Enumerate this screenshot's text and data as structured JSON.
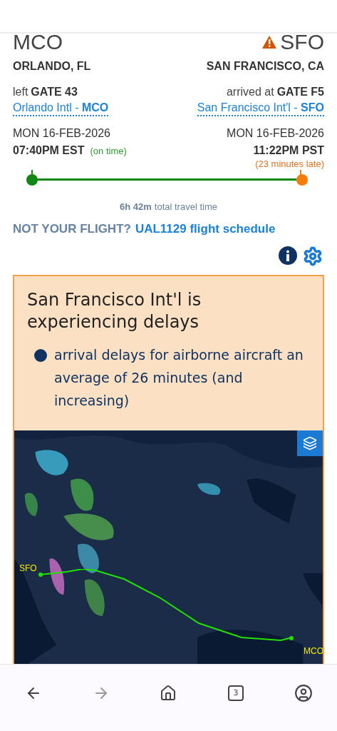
{
  "origin": {
    "code": "MCO",
    "city": "ORLANDO, FL",
    "gate_prefix": "left",
    "gate": "GATE 43",
    "airport_name": "Orlando Intl - ",
    "airport_code": "MCO",
    "date": "MON 16-FEB-2026",
    "time": "07:40PM EST",
    "status": "(on time)",
    "late": false
  },
  "destination": {
    "code": "SFO",
    "warning": true,
    "city": "SAN FRANCISCO, CA",
    "gate_prefix": "arrived at",
    "gate": "GATE F5",
    "airport_name": "San Francisco Int'l - ",
    "airport_code": "SFO",
    "date": "MON 16-FEB-2026",
    "time": "11:22PM PST",
    "status": "(23 minutes late)",
    "late": true
  },
  "progress": {
    "level": 1
  },
  "travel_time": {
    "value": "6h 42m",
    "label": "total travel time"
  },
  "not_your_flight": {
    "label": "NOT YOUR FLIGHT?",
    "link": "UAL1129 flight schedule"
  },
  "alert": {
    "title": "San Francisco Int'l is experiencing delays",
    "items": [
      "arrival delays for airborne aircraft an average of 26 minutes (and increasing)"
    ]
  },
  "map": {
    "kind": "picture",
    "markers": [
      {
        "label": "SFO"
      },
      {
        "label": "MCO"
      }
    ]
  },
  "nav": [
    {
      "kind": "back",
      "disabled": false
    },
    {
      "kind": "forward",
      "disabled": true
    },
    {
      "kind": "home",
      "disabled": false
    },
    {
      "kind": "tabs",
      "count": "3",
      "disabled": false
    },
    {
      "kind": "account",
      "disabled": false
    }
  ]
}
